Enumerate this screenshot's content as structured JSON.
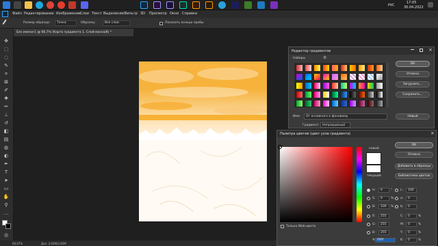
{
  "taskbar": {
    "time": "17:05",
    "date": "30.04.2022",
    "language": "РУС",
    "icons": [
      "start-icon",
      "search-icon",
      "explorer-icon",
      "edge-icon",
      "chrome-icon",
      "yandex-icon",
      "media-icon",
      "discord-icon",
      "photoshop-icon",
      "premiere-icon",
      "after-effects-icon",
      "audition-icon",
      "animate-icon",
      "illustrator-icon",
      "telegram-icon",
      "app-icon",
      "game-icon",
      "app2-icon",
      "app3-icon"
    ]
  },
  "menubar": {
    "items": [
      "Файл",
      "Редактирование",
      "Изображение",
      "Слои",
      "Текст",
      "Выделение",
      "Фильтр",
      "3D",
      "Просмотр",
      "Окно",
      "Справка"
    ]
  },
  "options": {
    "sample_size_label": "Размер образца:",
    "sample_size_value": "Точка",
    "sample_label": "Образец:",
    "sample_value": "Все слои",
    "show_ring": "Показать кольцо пробы"
  },
  "document": {
    "tab_title": "Без имени-1 @ 66,7% (Карта градиента 1, Слой-маска/8) *",
    "zoom": "66,67%",
    "doc_info": "Док: 2,92M/2,92M"
  },
  "gradient_editor": {
    "title": "Редактор градиентов",
    "presets_label": "Наборы",
    "ok": "ОК",
    "cancel": "Отмена",
    "load": "Загрузить...",
    "save": "Сохранить...",
    "new": "Новый",
    "name_label": "Имя:",
    "name_value": "От основного к фоновому",
    "type_label": "Градиент:",
    "type_value": "Непрерывный"
  },
  "color_picker": {
    "title": "Палитра цветов (цвет узла градиента)",
    "new_label": "новый",
    "current_label": "текущий",
    "ok": "ОК",
    "cancel": "Отмена",
    "add_swatches": "Добавить в образцы",
    "libraries": "Библиотеки цветов",
    "web_only": "Только Web-цвета",
    "fields": {
      "H": "0",
      "S": "0",
      "B": "100",
      "R": "255",
      "G": "255",
      "Bb": "255",
      "L": "100",
      "a": "0",
      "b": "0",
      "C": "0",
      "M": "0",
      "Y": "0",
      "K": "0",
      "hex": "ffffff"
    },
    "units": {
      "deg": "°",
      "pct": "%"
    }
  }
}
